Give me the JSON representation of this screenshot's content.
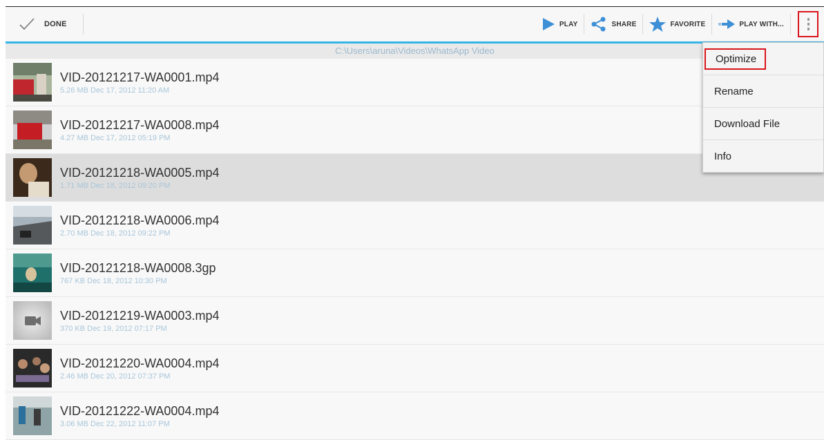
{
  "toolbar": {
    "done_label": "DONE",
    "play_label": "PLAY",
    "share_label": "SHARE",
    "favorite_label": "FAVORITE",
    "play_with_label": "PLAY WITH...",
    "overflow_icon": "more-vert-icon",
    "accent_color": "#33b5e5"
  },
  "path": "C:\\Users\\aruna\\Videos\\WhatsApp Video",
  "files": [
    {
      "name": "VID-20121217-WA0001.mp4",
      "info": "5.26 MB  Dec 17, 2012 11:20 AM"
    },
    {
      "name": "VID-20121217-WA0008.mp4",
      "info": "4.27 MB  Dec 17, 2012 05:19 PM"
    },
    {
      "name": "VID-20121218-WA0005.mp4",
      "info": "1.71 MB  Dec 18, 2012 09:20 PM"
    },
    {
      "name": "VID-20121218-WA0006.mp4",
      "info": "2.70 MB  Dec 18, 2012 09:22 PM"
    },
    {
      "name": "VID-20121218-WA0008.3gp",
      "info": "767 KB  Dec 18, 2012 10:30 PM"
    },
    {
      "name": "VID-20121219-WA0003.mp4",
      "info": "370 KB  Dec 19, 2012 07:17 PM"
    },
    {
      "name": "VID-20121220-WA0004.mp4",
      "info": "2.46 MB  Dec 20, 2012 07:37 PM"
    },
    {
      "name": "VID-20121222-WA0004.mp4",
      "info": "3.06 MB  Dec 22, 2012 11:07 PM"
    }
  ],
  "menu": {
    "items": [
      "Optimize",
      "Rename",
      "Download File",
      "Info"
    ]
  },
  "highlight_color": "#d9141b"
}
